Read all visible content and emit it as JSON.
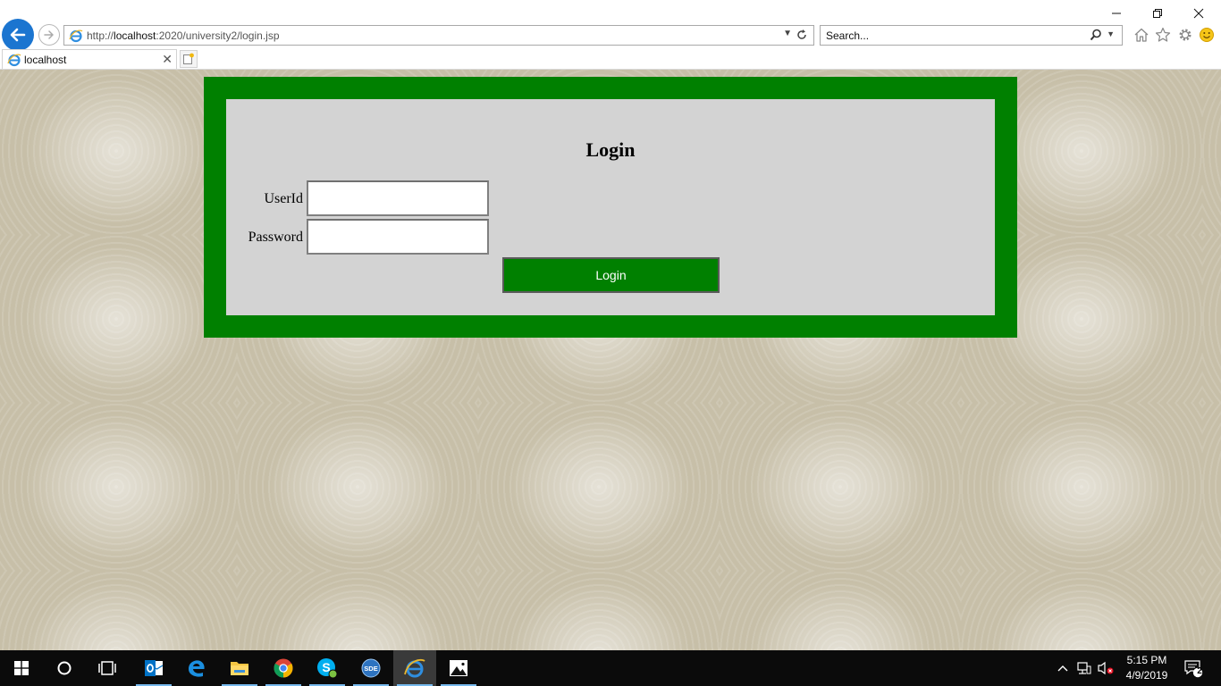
{
  "browser": {
    "url_prefix": "http://",
    "url_host": "localhost",
    "url_rest": ":2020/university2/login.jsp",
    "search_placeholder": "Search...",
    "tab_title": "localhost"
  },
  "login": {
    "title": "Login",
    "userid_label": "UserId",
    "password_label": "Password",
    "userid_value": "",
    "password_value": "",
    "button_label": "Login"
  },
  "taskbar": {
    "time": "5:15 PM",
    "date": "4/9/2019",
    "notification_count": "2"
  },
  "colors": {
    "frame_green": "#008000",
    "panel_gray": "#d3d3d3",
    "page_background": "#c7bfa8",
    "ie_blue": "#1b75d0"
  },
  "icons": [
    "back-icon",
    "forward-icon",
    "ie-icon",
    "refresh-icon",
    "search-icon",
    "home-icon",
    "favorites-icon",
    "settings-icon",
    "smiley-icon",
    "new-tab-icon",
    "windows-start-icon",
    "cortana-icon",
    "task-view-icon",
    "outlook-icon",
    "edge-icon",
    "file-explorer-icon",
    "chrome-icon",
    "skype-icon",
    "sde-icon",
    "internet-explorer-icon",
    "photos-icon",
    "chevron-up-icon",
    "network-icon",
    "volume-muted-icon",
    "action-center-icon"
  ]
}
